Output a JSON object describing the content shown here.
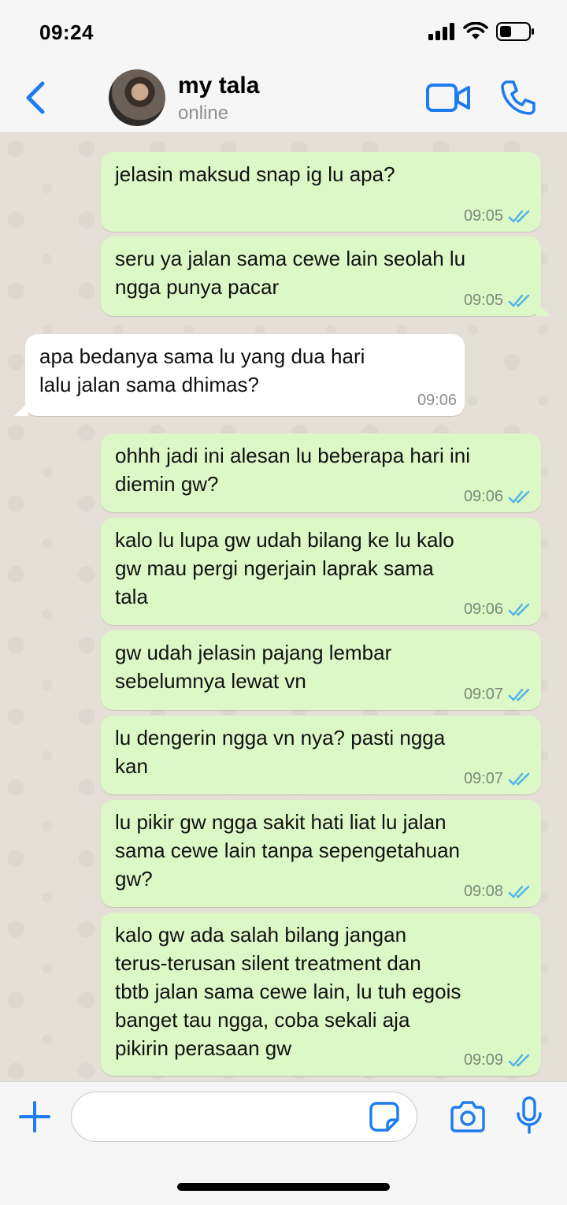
{
  "status_bar": {
    "time": "09:24"
  },
  "header": {
    "contact_name": "my tala",
    "contact_status": "online"
  },
  "colors": {
    "accent": "#1c7cf0",
    "outgoing_bubble": "#dcf8c6",
    "incoming_bubble": "#ffffff",
    "read_ticks": "#4fb4e8"
  },
  "messages": [
    {
      "dir": "out",
      "text": "jelasin maksud snap ig lu apa?",
      "time": "09:05",
      "read": true
    },
    {
      "dir": "out",
      "text": "seru ya jalan sama cewe lain seolah lu\nngga punya pacar",
      "time": "09:05",
      "read": true
    },
    {
      "dir": "in",
      "text": "apa bedanya sama lu yang dua hari\nlalu jalan sama dhimas?",
      "time": "09:06"
    },
    {
      "dir": "out",
      "text": "ohhh jadi ini alesan lu beberapa hari ini\ndiemin gw?",
      "time": "09:06",
      "read": true
    },
    {
      "dir": "out",
      "text": "kalo lu lupa gw udah bilang ke lu kalo\ngw mau pergi ngerjain laprak sama\ntala",
      "time": "09:06",
      "read": true
    },
    {
      "dir": "out",
      "text": "gw udah jelasin pajang lembar\nsebelumnya lewat vn",
      "time": "09:07",
      "read": true
    },
    {
      "dir": "out",
      "text": "lu dengerin ngga vn nya? pasti ngga\nkan",
      "time": "09:07",
      "read": true
    },
    {
      "dir": "out",
      "text": "lu pikir gw ngga sakit hati liat lu jalan\nsama cewe lain tanpa sepengetahuan\ngw?",
      "time": "09:08",
      "read": true
    },
    {
      "dir": "out",
      "text": "kalo gw ada salah bilang jangan\nterus-terusan silent treatment dan\ntbtb jalan sama cewe lain, lu tuh egois\nbanget tau ngga, coba sekali aja\npikirin perasaan gw",
      "time": "09:09",
      "read": true
    }
  ],
  "composer": {
    "placeholder": ""
  }
}
